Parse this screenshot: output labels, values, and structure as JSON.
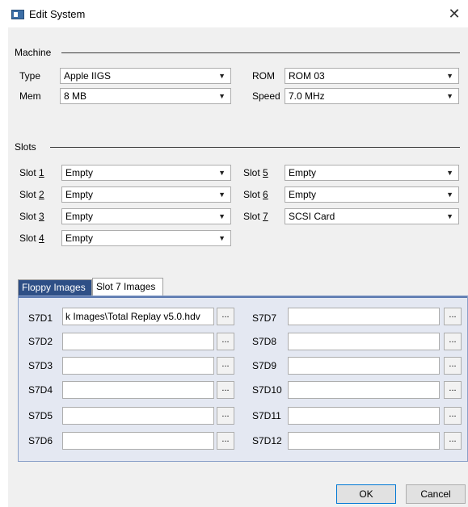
{
  "window": {
    "title": "Edit System",
    "close_glyph": "✕"
  },
  "machine": {
    "section_label": "Machine",
    "type_label": "Type",
    "type_value": "Apple IIGS",
    "rom_label": "ROM",
    "rom_value": "ROM 03",
    "mem_label": "Mem",
    "mem_value": "8 MB",
    "speed_label": "Speed",
    "speed_value": "7.0 MHz"
  },
  "slots": {
    "section_label": "Slots",
    "items": [
      {
        "prefix": "Slot ",
        "num": "1",
        "value": "Empty"
      },
      {
        "prefix": "Slot ",
        "num": "2",
        "value": "Empty"
      },
      {
        "prefix": "Slot ",
        "num": "3",
        "value": "Empty"
      },
      {
        "prefix": "Slot ",
        "num": "4",
        "value": "Empty"
      },
      {
        "prefix": "Slot ",
        "num": "5",
        "value": "Empty"
      },
      {
        "prefix": "Slot ",
        "num": "6",
        "value": "Empty"
      },
      {
        "prefix": "Slot ",
        "num": "7",
        "value": "SCSI Card"
      }
    ]
  },
  "tabs": [
    "Floppy Images",
    "Slot 7 Images"
  ],
  "images": {
    "browse_label": "...",
    "drives": [
      {
        "label": "S7D1",
        "value": "k Images\\Total Replay v5.0.hdv"
      },
      {
        "label": "S7D2",
        "value": ""
      },
      {
        "label": "S7D3",
        "value": ""
      },
      {
        "label": "S7D4",
        "value": ""
      },
      {
        "label": "S7D5",
        "value": ""
      },
      {
        "label": "S7D6",
        "value": ""
      },
      {
        "label": "S7D7",
        "value": ""
      },
      {
        "label": "S7D8",
        "value": ""
      },
      {
        "label": "S7D9",
        "value": ""
      },
      {
        "label": "S7D10",
        "value": ""
      },
      {
        "label": "S7D11",
        "value": ""
      },
      {
        "label": "S7D12",
        "value": ""
      }
    ]
  },
  "buttons": {
    "ok": "OK",
    "cancel": "Cancel"
  },
  "icons": {
    "app": "window-app-icon",
    "dropdown": "chevron-down-icon"
  },
  "colors": {
    "tab_inactive_bg": "#2e4f86",
    "panel_bg": "#e4e8f2",
    "default_button_border": "#0078d4"
  }
}
